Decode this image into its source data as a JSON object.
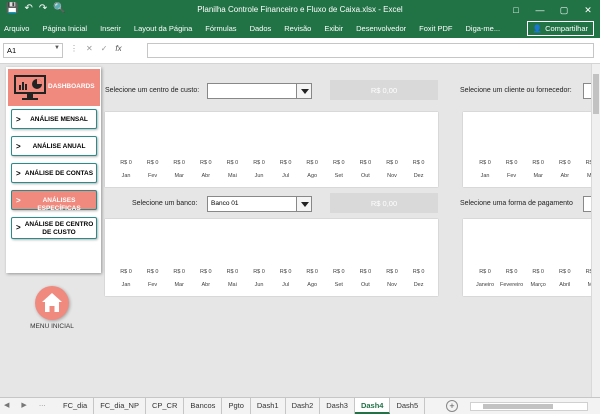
{
  "window": {
    "title": "Planilha Controle Financeiro e Fluxo de Caixa.xlsx  -  Excel"
  },
  "ribbon": {
    "tabs": [
      "Arquivo",
      "Página Inicial",
      "Inserir",
      "Layout da Página",
      "Fórmulas",
      "Dados",
      "Revisão",
      "Exibir",
      "Desenvolvedor",
      "Foxit PDF",
      "Diga-me..."
    ],
    "share_label": "Compartilhar"
  },
  "formula_bar": {
    "name_box": "A1",
    "fx_label": "fx",
    "formula": ""
  },
  "dashboard": {
    "header_label": "DASHBOARDS",
    "menu": [
      {
        "label": "ANÁLISE MENSAL",
        "active": false
      },
      {
        "label": "ANÁLISE ANUAL",
        "active": false
      },
      {
        "label": "ANÁLISE DE CONTAS",
        "active": false
      },
      {
        "label": "ANÁLISES ESPECÍFICAS",
        "active": true
      },
      {
        "label": "ANÁLISE DE CENTRO DE CUSTO",
        "active": false
      }
    ],
    "chevron": ">",
    "home_label": "MENU INICIAL"
  },
  "filters": {
    "cost_center_label": "Selecione um centro de custo:",
    "cost_center_value": "",
    "cost_center_total": "R$ 0,00",
    "client_label": "Selecione um cliente ou fornecedor:",
    "bank_label": "Selecione um banco:",
    "bank_value": "Banco 01",
    "bank_total": "R$ 0,00",
    "payment_label": "Selecione uma forma de pagamento"
  },
  "chart_data": [
    {
      "type": "bar",
      "categories": [
        "Jan",
        "Fev",
        "Mar",
        "Abr",
        "Mai",
        "Jun",
        "Jul",
        "Ago",
        "Set",
        "Out",
        "Nov",
        "Dez"
      ],
      "values": [
        0,
        0,
        0,
        0,
        0,
        0,
        0,
        0,
        0,
        0,
        0,
        0
      ],
      "data_label": "R$ 0"
    },
    {
      "type": "bar",
      "categories": [
        "Jan",
        "Fev",
        "Mar",
        "Abr",
        "Mai"
      ],
      "values": [
        0,
        0,
        0,
        0,
        0
      ],
      "data_label": "R$ 0"
    },
    {
      "type": "bar",
      "categories": [
        "Jan",
        "Fev",
        "Mar",
        "Abr",
        "Mai",
        "Jun",
        "Jul",
        "Ago",
        "Set",
        "Out",
        "Nov",
        "Dez"
      ],
      "values": [
        0,
        0,
        0,
        0,
        0,
        0,
        0,
        0,
        0,
        0,
        0,
        0
      ],
      "data_label": "R$ 0"
    },
    {
      "type": "bar",
      "categories": [
        "Janeiro",
        "Fevereiro",
        "Março",
        "Abril",
        "Ma"
      ],
      "values": [
        0,
        0,
        0,
        0,
        0
      ],
      "data_label": "R$ 0"
    }
  ],
  "sheet_tabs": [
    "FC_dia",
    "FC_dia_NP",
    "CP_CR",
    "Bancos",
    "Pgto",
    "Dash1",
    "Dash2",
    "Dash3",
    "Dash4",
    "Dash5"
  ],
  "active_sheet": "Dash4",
  "colors": {
    "excel_green": "#217346",
    "accent_salmon": "#f08a7e",
    "menu_border": "#2b8a8a"
  }
}
